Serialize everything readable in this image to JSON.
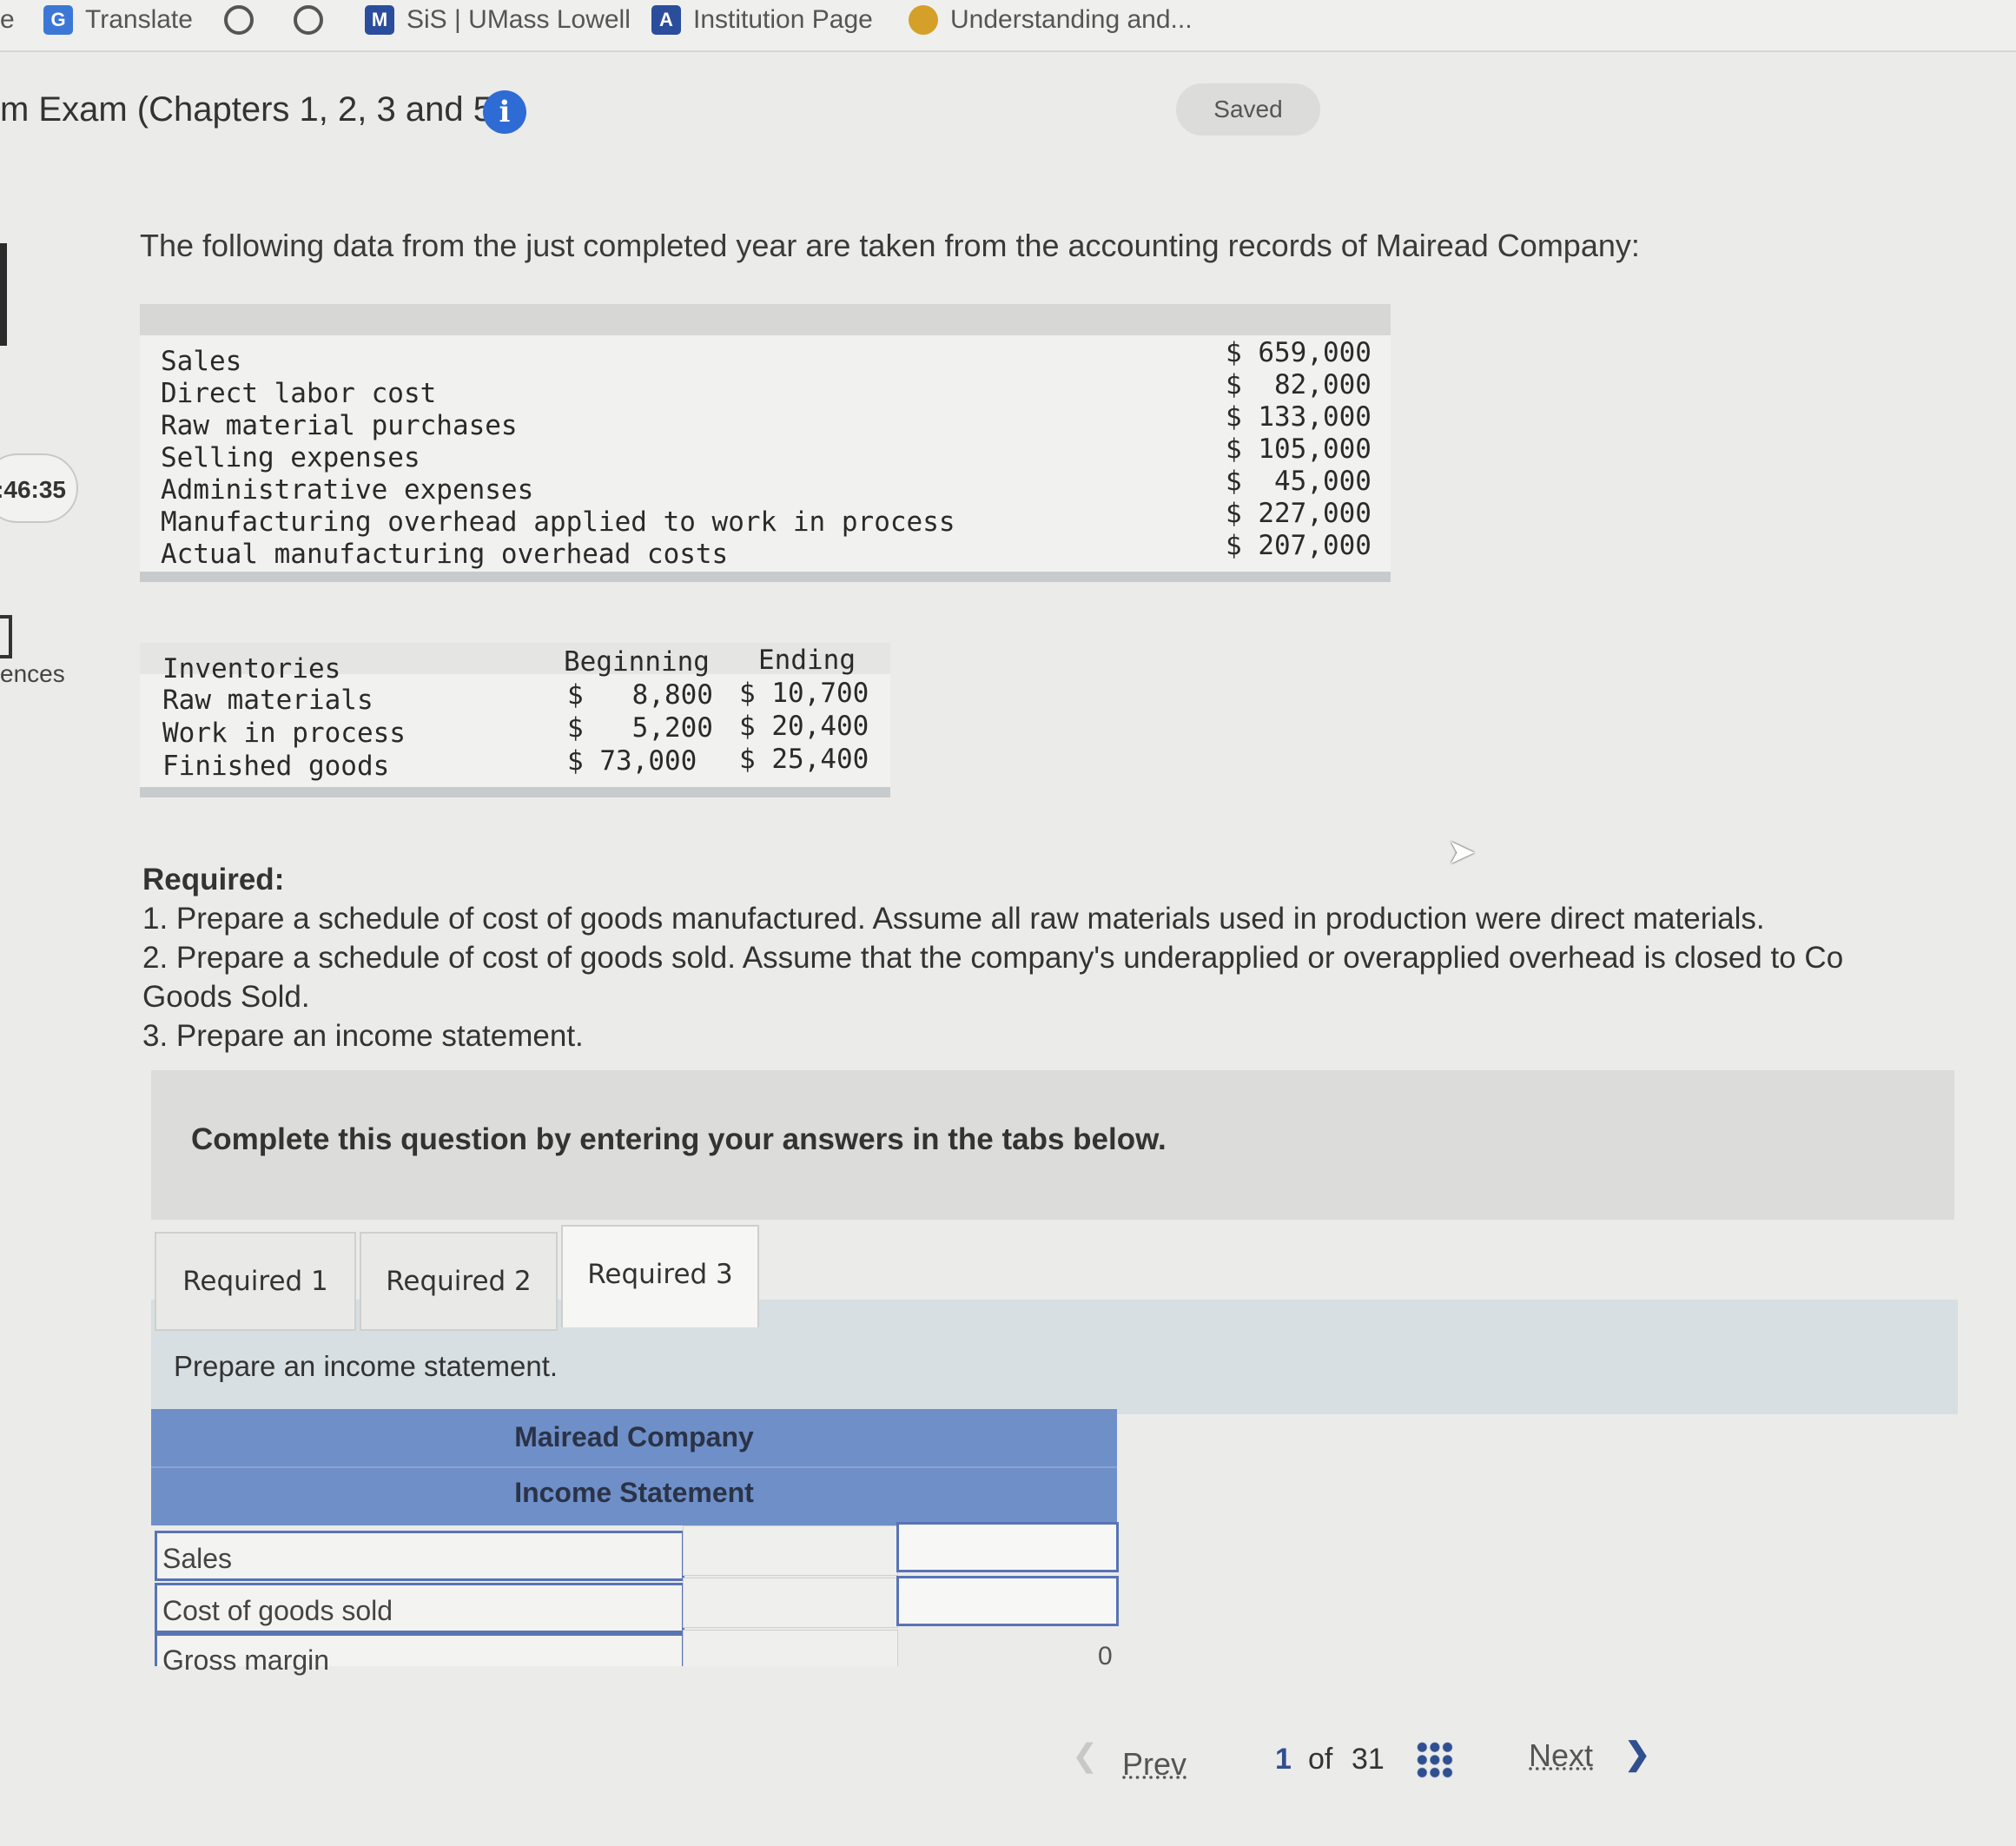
{
  "bookmarks": [
    {
      "label": "Translate",
      "icon": "google-translate-icon"
    },
    {
      "label": "",
      "icon": "globe-icon"
    },
    {
      "label": "",
      "icon": "globe-icon"
    },
    {
      "label": "SiS | UMass Lowell",
      "icon": "sis-icon"
    },
    {
      "label": "Institution Page",
      "icon": "institution-icon"
    },
    {
      "label": "Understanding and...",
      "icon": "understanding-icon"
    }
  ],
  "header": {
    "title": "m Exam (Chapters 1, 2, 3 and 5)",
    "info_icon": "i",
    "saved": "Saved"
  },
  "sidebar": {
    "timer": ":46:35",
    "references": "ences"
  },
  "question": {
    "intro": "The following data from the just completed year are taken from the accounting records of Mairead Company:",
    "table1": [
      {
        "label": "Sales",
        "value": "$ 659,000"
      },
      {
        "label": "Direct labor cost",
        "value": "$  82,000"
      },
      {
        "label": "Raw material purchases",
        "value": "$ 133,000"
      },
      {
        "label": "Selling expenses",
        "value": "$ 105,000"
      },
      {
        "label": "Administrative expenses",
        "value": "$  45,000"
      },
      {
        "label": "Manufacturing overhead applied to work in process",
        "value": "$ 227,000"
      },
      {
        "label": "Actual manufacturing overhead costs",
        "value": "$ 207,000"
      }
    ],
    "table2": {
      "headers": [
        "Inventories",
        "Beginning",
        "Ending"
      ],
      "rows": [
        {
          "label": "Raw materials",
          "beginning": "$   8,800",
          "ending": "$ 10,700"
        },
        {
          "label": "Work in process",
          "beginning": "$   5,200",
          "ending": "$ 20,400"
        },
        {
          "label": "Finished goods",
          "beginning": "$ 73,000",
          "ending": "$ 25,400"
        }
      ]
    },
    "required_heading": "Required:",
    "required_items": [
      "1. Prepare a schedule of cost of goods manufactured. Assume all raw materials used in production were direct materials.",
      "2. Prepare a schedule of cost of goods sold. Assume that the company's underapplied or overapplied overhead is closed to Co",
      "Goods Sold.",
      "3. Prepare an income statement."
    ]
  },
  "instructions": "Complete this question by entering your answers in the tabs below.",
  "tabs": [
    {
      "label": "Required 1"
    },
    {
      "label": "Required 2"
    },
    {
      "label": "Required 3"
    }
  ],
  "active_tab_prompt": "Prepare an income statement.",
  "statement": {
    "company": "Mairead Company",
    "title": "Income Statement",
    "rows": [
      {
        "label": "Sales"
      },
      {
        "label": "Cost of goods sold"
      },
      {
        "label": "Gross margin"
      }
    ],
    "gross_margin_value": "0"
  },
  "pager": {
    "prev": "Prev",
    "page": "1",
    "of": "of",
    "total": "31",
    "next": "Next"
  }
}
